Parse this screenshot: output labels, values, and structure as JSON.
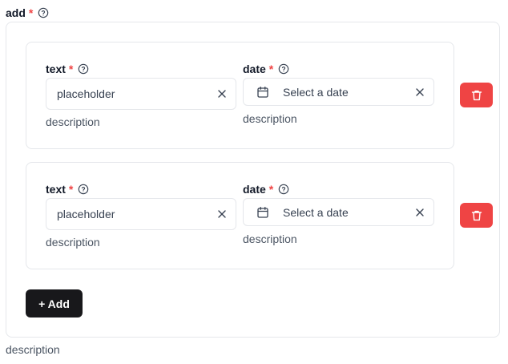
{
  "group": {
    "label": "add",
    "required_mark": "*",
    "description": "description"
  },
  "items": [
    {
      "text_field": {
        "label": "text",
        "required_mark": "*",
        "value": "placeholder",
        "description": "description"
      },
      "date_field": {
        "label": "date",
        "required_mark": "*",
        "placeholder": "Select a date",
        "description": "description"
      }
    },
    {
      "text_field": {
        "label": "text",
        "required_mark": "*",
        "value": "placeholder",
        "description": "description"
      },
      "date_field": {
        "label": "date",
        "required_mark": "*",
        "placeholder": "Select a date",
        "description": "description"
      }
    }
  ],
  "add_button": {
    "label": "+ Add"
  },
  "colors": {
    "required": "#ef4444",
    "delete_button": "#ef4444",
    "add_button": "#18181b",
    "border": "#e5e7eb"
  },
  "icons": {
    "help": "help-circle-icon",
    "clear": "close-icon",
    "calendar": "calendar-icon",
    "delete": "trash-icon"
  }
}
